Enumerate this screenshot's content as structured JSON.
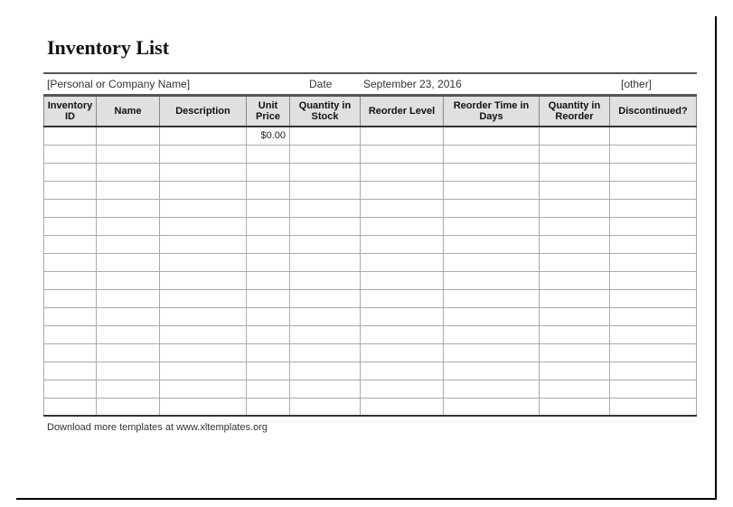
{
  "title": "Inventory List",
  "meta": {
    "company_placeholder": "[Personal or Company Name]",
    "date_label": "Date",
    "date_value": "September 23, 2016",
    "other_placeholder": "[other]"
  },
  "columns": {
    "inventory_id": "Inventory ID",
    "name": "Name",
    "description": "Description",
    "unit_price": "Unit Price",
    "qty_stock": "Quantity in Stock",
    "reorder_level": "Reorder Level",
    "reorder_time": "Reorder Time in Days",
    "qty_reorder": "Quantity in Reorder",
    "discontinued": "Discontinued?"
  },
  "rows": [
    {
      "inventory_id": "",
      "name": "",
      "description": "",
      "unit_price": "$0.00",
      "qty_stock": "",
      "reorder_level": "",
      "reorder_time": "",
      "qty_reorder": "",
      "discontinued": ""
    },
    {
      "inventory_id": "",
      "name": "",
      "description": "",
      "unit_price": "",
      "qty_stock": "",
      "reorder_level": "",
      "reorder_time": "",
      "qty_reorder": "",
      "discontinued": ""
    },
    {
      "inventory_id": "",
      "name": "",
      "description": "",
      "unit_price": "",
      "qty_stock": "",
      "reorder_level": "",
      "reorder_time": "",
      "qty_reorder": "",
      "discontinued": ""
    },
    {
      "inventory_id": "",
      "name": "",
      "description": "",
      "unit_price": "",
      "qty_stock": "",
      "reorder_level": "",
      "reorder_time": "",
      "qty_reorder": "",
      "discontinued": ""
    },
    {
      "inventory_id": "",
      "name": "",
      "description": "",
      "unit_price": "",
      "qty_stock": "",
      "reorder_level": "",
      "reorder_time": "",
      "qty_reorder": "",
      "discontinued": ""
    },
    {
      "inventory_id": "",
      "name": "",
      "description": "",
      "unit_price": "",
      "qty_stock": "",
      "reorder_level": "",
      "reorder_time": "",
      "qty_reorder": "",
      "discontinued": ""
    },
    {
      "inventory_id": "",
      "name": "",
      "description": "",
      "unit_price": "",
      "qty_stock": "",
      "reorder_level": "",
      "reorder_time": "",
      "qty_reorder": "",
      "discontinued": ""
    },
    {
      "inventory_id": "",
      "name": "",
      "description": "",
      "unit_price": "",
      "qty_stock": "",
      "reorder_level": "",
      "reorder_time": "",
      "qty_reorder": "",
      "discontinued": ""
    },
    {
      "inventory_id": "",
      "name": "",
      "description": "",
      "unit_price": "",
      "qty_stock": "",
      "reorder_level": "",
      "reorder_time": "",
      "qty_reorder": "",
      "discontinued": ""
    },
    {
      "inventory_id": "",
      "name": "",
      "description": "",
      "unit_price": "",
      "qty_stock": "",
      "reorder_level": "",
      "reorder_time": "",
      "qty_reorder": "",
      "discontinued": ""
    },
    {
      "inventory_id": "",
      "name": "",
      "description": "",
      "unit_price": "",
      "qty_stock": "",
      "reorder_level": "",
      "reorder_time": "",
      "qty_reorder": "",
      "discontinued": ""
    },
    {
      "inventory_id": "",
      "name": "",
      "description": "",
      "unit_price": "",
      "qty_stock": "",
      "reorder_level": "",
      "reorder_time": "",
      "qty_reorder": "",
      "discontinued": ""
    },
    {
      "inventory_id": "",
      "name": "",
      "description": "",
      "unit_price": "",
      "qty_stock": "",
      "reorder_level": "",
      "reorder_time": "",
      "qty_reorder": "",
      "discontinued": ""
    },
    {
      "inventory_id": "",
      "name": "",
      "description": "",
      "unit_price": "",
      "qty_stock": "",
      "reorder_level": "",
      "reorder_time": "",
      "qty_reorder": "",
      "discontinued": ""
    },
    {
      "inventory_id": "",
      "name": "",
      "description": "",
      "unit_price": "",
      "qty_stock": "",
      "reorder_level": "",
      "reorder_time": "",
      "qty_reorder": "",
      "discontinued": ""
    },
    {
      "inventory_id": "",
      "name": "",
      "description": "",
      "unit_price": "",
      "qty_stock": "",
      "reorder_level": "",
      "reorder_time": "",
      "qty_reorder": "",
      "discontinued": ""
    }
  ],
  "footer": "Download more templates at www.xltemplates.org"
}
